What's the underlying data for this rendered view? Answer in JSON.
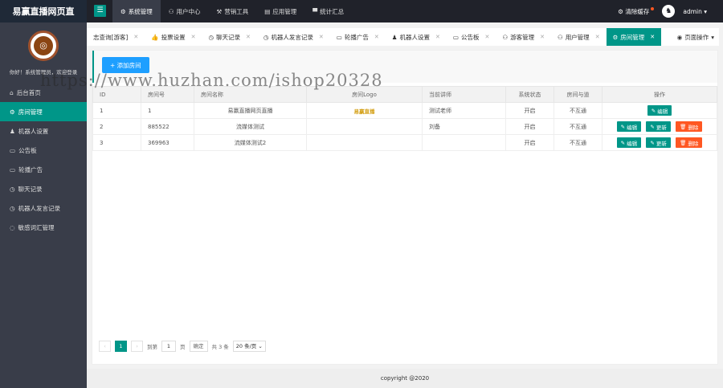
{
  "topbar": {
    "logo": "易赢直播网页直",
    "hamburger": "☰",
    "nav": [
      {
        "icon": "⚙",
        "label": "系统管理"
      },
      {
        "icon": "⚇",
        "label": "用户中心"
      },
      {
        "icon": "⚒",
        "label": "营销工具"
      },
      {
        "icon": "▤",
        "label": "应用管理"
      },
      {
        "icon": "▀",
        "label": "统计汇总"
      }
    ],
    "clear_cache": "清除缓存",
    "user": "admin ▾"
  },
  "sidebar": {
    "greeting": "你好！系统管理员，欢迎登录",
    "items": [
      {
        "icon": "⌂",
        "label": "后台首页"
      },
      {
        "icon": "⚙",
        "label": "房间管理"
      },
      {
        "icon": "♟",
        "label": "机器人设置"
      },
      {
        "icon": "▭",
        "label": "公告板"
      },
      {
        "icon": "▭",
        "label": "轮播广告"
      },
      {
        "icon": "◷",
        "label": "聊天记录"
      },
      {
        "icon": "◷",
        "label": "机器人发言记录"
      },
      {
        "icon": "◌",
        "label": "敏感词汇管理"
      }
    ]
  },
  "tabs": [
    {
      "icon": "",
      "label": "志查询[游客]"
    },
    {
      "icon": "👍",
      "label": "投票设置"
    },
    {
      "icon": "◷",
      "label": "聊天记录"
    },
    {
      "icon": "◷",
      "label": "机器人发言记录"
    },
    {
      "icon": "▭",
      "label": "轮播广告"
    },
    {
      "icon": "♟",
      "label": "机器人设置"
    },
    {
      "icon": "▭",
      "label": "公告板"
    },
    {
      "icon": "⚇",
      "label": "游客管理"
    },
    {
      "icon": "⚇",
      "label": "用户管理"
    },
    {
      "icon": "⚙",
      "label": "房间管理"
    }
  ],
  "tab_ops": "页面操作",
  "add_button": "+ 添加房间",
  "table": {
    "headers": [
      "ID",
      "房间号",
      "房间名称",
      "房间Logo",
      "当前讲师",
      "系统状态",
      "房间与道",
      "操作"
    ],
    "rows": [
      {
        "id": "1",
        "room_no": "1",
        "name": "易赢直播网页直播",
        "logo": "易赢直播",
        "teacher": "测试老师",
        "status": "开启",
        "flag": "不互通",
        "actions": [
          "编辑"
        ]
      },
      {
        "id": "2",
        "room_no": "885522",
        "name": "流媒体测试",
        "logo": "",
        "teacher": "刘备",
        "status": "开启",
        "flag": "不互通",
        "actions": [
          "编辑",
          "更新",
          "删除"
        ]
      },
      {
        "id": "3",
        "room_no": "369963",
        "name": "流媒体测试2",
        "logo": "",
        "teacher": "",
        "status": "开启",
        "flag": "不互通",
        "actions": [
          "编辑",
          "更新",
          "删除"
        ]
      }
    ]
  },
  "pager": {
    "current": "1",
    "goto_label": "到第",
    "goto_value": "1",
    "page_unit": "页",
    "ok": "确定",
    "total": "共 3 条",
    "per_page": "20 条/页 ⌄"
  },
  "footer": "copyright @2020",
  "watermark": "https://www.huzhan.com/ishop20328",
  "colors": {
    "accent": "#009688",
    "primary": "#1e9fff",
    "danger": "#ff5722"
  }
}
